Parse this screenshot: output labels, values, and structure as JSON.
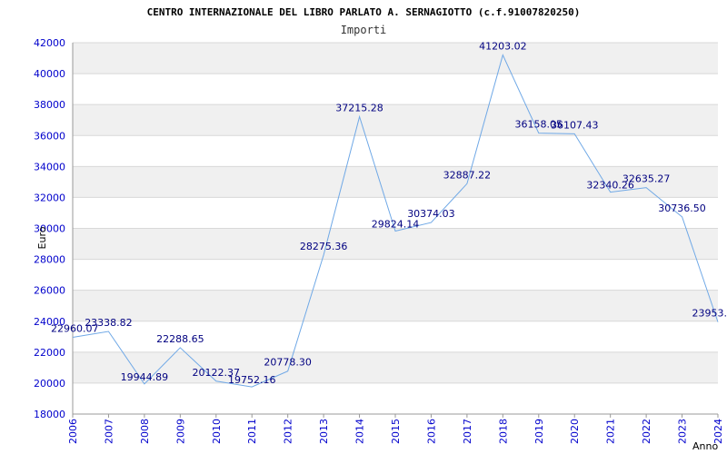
{
  "chart_data": {
    "type": "line",
    "title": "CENTRO INTERNAZIONALE DEL LIBRO PARLATO A. SERNAGIOTTO (c.f.91007820250)",
    "subtitle": "Importi",
    "xlabel": "Anno",
    "ylabel": "Euro",
    "ylim": [
      18000,
      42000
    ],
    "yticks": [
      18000,
      20000,
      22000,
      24000,
      26000,
      28000,
      30000,
      32000,
      34000,
      36000,
      38000,
      40000,
      42000
    ],
    "x": [
      "2006",
      "2007",
      "2008",
      "2009",
      "2010",
      "2011",
      "2012",
      "2013",
      "2014",
      "2015",
      "2016",
      "2017",
      "2018",
      "2019",
      "2020",
      "2021",
      "2022",
      "2023",
      "2024"
    ],
    "values": [
      22960.07,
      23338.82,
      19944.89,
      22288.65,
      20122.37,
      19752.16,
      20778.3,
      28275.36,
      37215.28,
      29824.14,
      30374.03,
      32887.22,
      41203.02,
      36158.05,
      36107.43,
      32340.26,
      32635.27,
      30736.5,
      23953
    ],
    "labels": [
      "22960.07",
      "23338.82",
      "19944.89",
      "22288.65",
      "20122.37",
      "19752.16",
      "20778.30",
      "28275.36",
      "37215.28",
      "29824.14",
      "30374.03",
      "32887.22",
      "41203.02",
      "36158.05",
      "36107.43",
      "32340.26",
      "32635.27",
      "30736.50",
      "23953."
    ],
    "grid": true,
    "colors": {
      "line": "#6fa8e6",
      "band": "#f0f0f0",
      "grid": "#d8d8d8",
      "tick": "#0000cc",
      "data_label": "#000080"
    }
  }
}
